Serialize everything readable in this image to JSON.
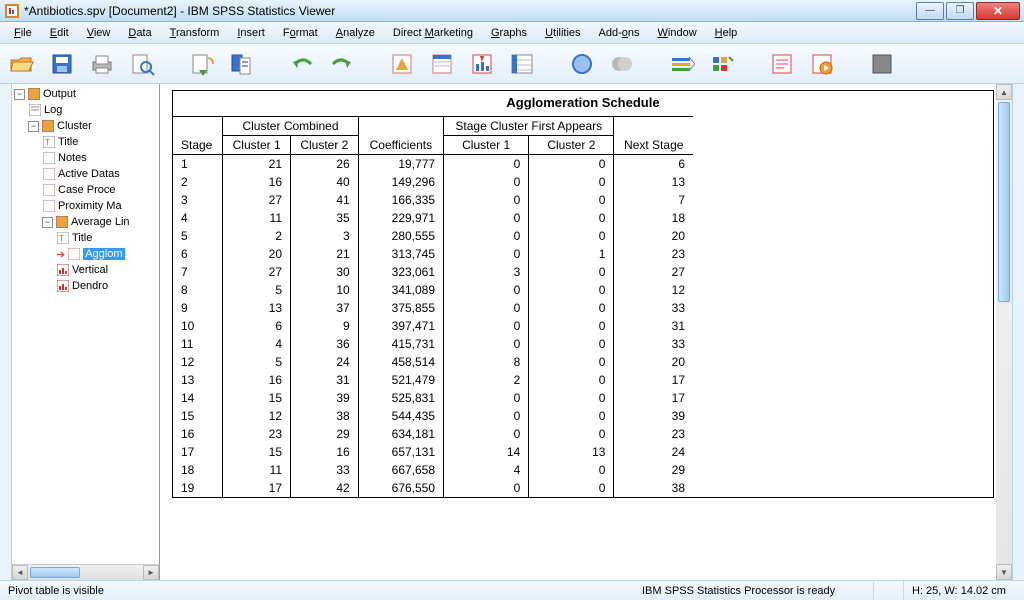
{
  "window": {
    "title": "*Antibiotics.spv [Document2] - IBM SPSS Statistics Viewer"
  },
  "menu": {
    "file": "File",
    "edit": "Edit",
    "view": "View",
    "data": "Data",
    "transform": "Transform",
    "insert": "Insert",
    "format": "Format",
    "analyze": "Analyze",
    "direct_marketing": "Direct Marketing",
    "graphs": "Graphs",
    "utilities": "Utilities",
    "addons": "Add-ons",
    "window": "Window",
    "help": "Help"
  },
  "outline": {
    "root": "Output",
    "log": "Log",
    "cluster": "Cluster",
    "title": "Title",
    "notes": "Notes",
    "active_ds": "Active Datas",
    "case_proc": "Case Proce",
    "proximity": "Proximity Ma",
    "avg_link": "Average Lin",
    "avg_title": "Title",
    "agglom": "Agglom",
    "vertical": "Vertical",
    "dendro": "Dendro"
  },
  "pivot": {
    "title": "Agglomeration Schedule",
    "hdr_stage": "Stage",
    "hdr_cluster_combined": "Cluster Combined",
    "hdr_c1": "Cluster 1",
    "hdr_c2": "Cluster 2",
    "hdr_coef": "Coefficients",
    "hdr_first_appears": "Stage Cluster First Appears",
    "hdr_next": "Next Stage"
  },
  "rows": [
    {
      "stage": "1",
      "c1": "21",
      "c2": "26",
      "coef": "19,777",
      "f1": "0",
      "f2": "0",
      "next": "6"
    },
    {
      "stage": "2",
      "c1": "16",
      "c2": "40",
      "coef": "149,296",
      "f1": "0",
      "f2": "0",
      "next": "13"
    },
    {
      "stage": "3",
      "c1": "27",
      "c2": "41",
      "coef": "166,335",
      "f1": "0",
      "f2": "0",
      "next": "7"
    },
    {
      "stage": "4",
      "c1": "11",
      "c2": "35",
      "coef": "229,971",
      "f1": "0",
      "f2": "0",
      "next": "18"
    },
    {
      "stage": "5",
      "c1": "2",
      "c2": "3",
      "coef": "280,555",
      "f1": "0",
      "f2": "0",
      "next": "20"
    },
    {
      "stage": "6",
      "c1": "20",
      "c2": "21",
      "coef": "313,745",
      "f1": "0",
      "f2": "1",
      "next": "23"
    },
    {
      "stage": "7",
      "c1": "27",
      "c2": "30",
      "coef": "323,061",
      "f1": "3",
      "f2": "0",
      "next": "27"
    },
    {
      "stage": "8",
      "c1": "5",
      "c2": "10",
      "coef": "341,089",
      "f1": "0",
      "f2": "0",
      "next": "12"
    },
    {
      "stage": "9",
      "c1": "13",
      "c2": "37",
      "coef": "375,855",
      "f1": "0",
      "f2": "0",
      "next": "33"
    },
    {
      "stage": "10",
      "c1": "6",
      "c2": "9",
      "coef": "397,471",
      "f1": "0",
      "f2": "0",
      "next": "31"
    },
    {
      "stage": "11",
      "c1": "4",
      "c2": "36",
      "coef": "415,731",
      "f1": "0",
      "f2": "0",
      "next": "33"
    },
    {
      "stage": "12",
      "c1": "5",
      "c2": "24",
      "coef": "458,514",
      "f1": "8",
      "f2": "0",
      "next": "20"
    },
    {
      "stage": "13",
      "c1": "16",
      "c2": "31",
      "coef": "521,479",
      "f1": "2",
      "f2": "0",
      "next": "17"
    },
    {
      "stage": "14",
      "c1": "15",
      "c2": "39",
      "coef": "525,831",
      "f1": "0",
      "f2": "0",
      "next": "17"
    },
    {
      "stage": "15",
      "c1": "12",
      "c2": "38",
      "coef": "544,435",
      "f1": "0",
      "f2": "0",
      "next": "39"
    },
    {
      "stage": "16",
      "c1": "23",
      "c2": "29",
      "coef": "634,181",
      "f1": "0",
      "f2": "0",
      "next": "23"
    },
    {
      "stage": "17",
      "c1": "15",
      "c2": "16",
      "coef": "657,131",
      "f1": "14",
      "f2": "13",
      "next": "24"
    },
    {
      "stage": "18",
      "c1": "11",
      "c2": "33",
      "coef": "667,658",
      "f1": "4",
      "f2": "0",
      "next": "29"
    },
    {
      "stage": "19",
      "c1": "17",
      "c2": "42",
      "coef": "676,550",
      "f1": "0",
      "f2": "0",
      "next": "38"
    }
  ],
  "status": {
    "left": "Pivot table is visible",
    "processor": "IBM SPSS Statistics Processor is ready",
    "dims": "H: 25, W: 14.02 cm"
  }
}
